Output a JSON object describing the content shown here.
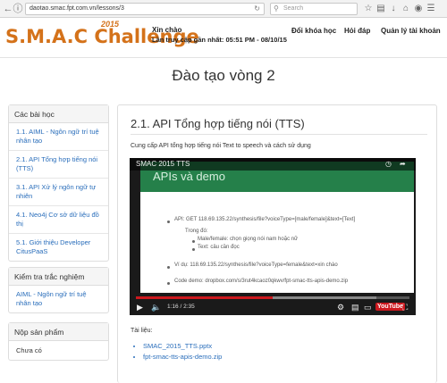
{
  "browser": {
    "url": "daotao.smac.fpt.com.vn/lessons/3",
    "search_placeholder": "Search"
  },
  "header": {
    "logo_text": "S.M.A.C Challenge",
    "logo_year": "2015",
    "greeting": "Xin chào",
    "last_access": "Lần truy cập gần nhất: 05:51 PM - 08/10/15",
    "nav": [
      "Đổi khóa học",
      "Hỏi đáp",
      "Quản lý tài khoản"
    ]
  },
  "page_title": "Đào tạo vòng 2",
  "sidebar": {
    "lessons_heading": "Các bài học",
    "lessons": [
      "1.1. AIML - Ngôn ngữ trí tuệ nhân tạo",
      "2.1. API Tổng hợp tiếng nói (TTS)",
      "3.1. API Xử lý ngôn ngữ tự nhiên",
      "4.1. Neo4j Cơ sở dữ liệu đồ thị",
      "5.1. Giới thiệu Developer CitusPaaS"
    ],
    "quiz_heading": "Kiểm tra trắc nghiệm",
    "quiz_items": [
      "AIML - Ngôn ngữ trí tuệ nhân tạo"
    ],
    "submit_heading": "Nộp sản phẩm",
    "submit_status": "Chưa có"
  },
  "lesson": {
    "title": "2.1. API Tổng hợp tiếng nói (TTS)",
    "description": "Cung cấp API tổng hợp tiếng nói Text to speech và cách sử dụng",
    "video": {
      "title": "SMAC 2015 TTS",
      "slide_heading": "APIs và demo",
      "slide_api": "API: GET 118.69.135.22/synthesis/file?voiceType=[male/female]&text=[Text]",
      "slide_trong_do": "Trong đó:",
      "slide_male_female": "Male/female: chọn giọng nói nam hoặc nữ",
      "slide_text": "Text: câu cần đọc",
      "slide_example": "Ví dụ: 118.69.135.22/synthesis/file?voiceType=female&text=xin chào",
      "slide_code": "Code demo: dropbox.com/s/3rut4kcaoz0qkwv/fpt-smac-tts-apis-demo.zip",
      "time": "1:16 / 2:35",
      "progress": 0.5,
      "buffered": 0.88,
      "yt_label": "YouTube"
    },
    "docs_label": "Tài liệu:",
    "docs": [
      "SMAC_2015_TTS.pptx",
      "fpt-smac-tts-apis-demo.zip"
    ]
  }
}
